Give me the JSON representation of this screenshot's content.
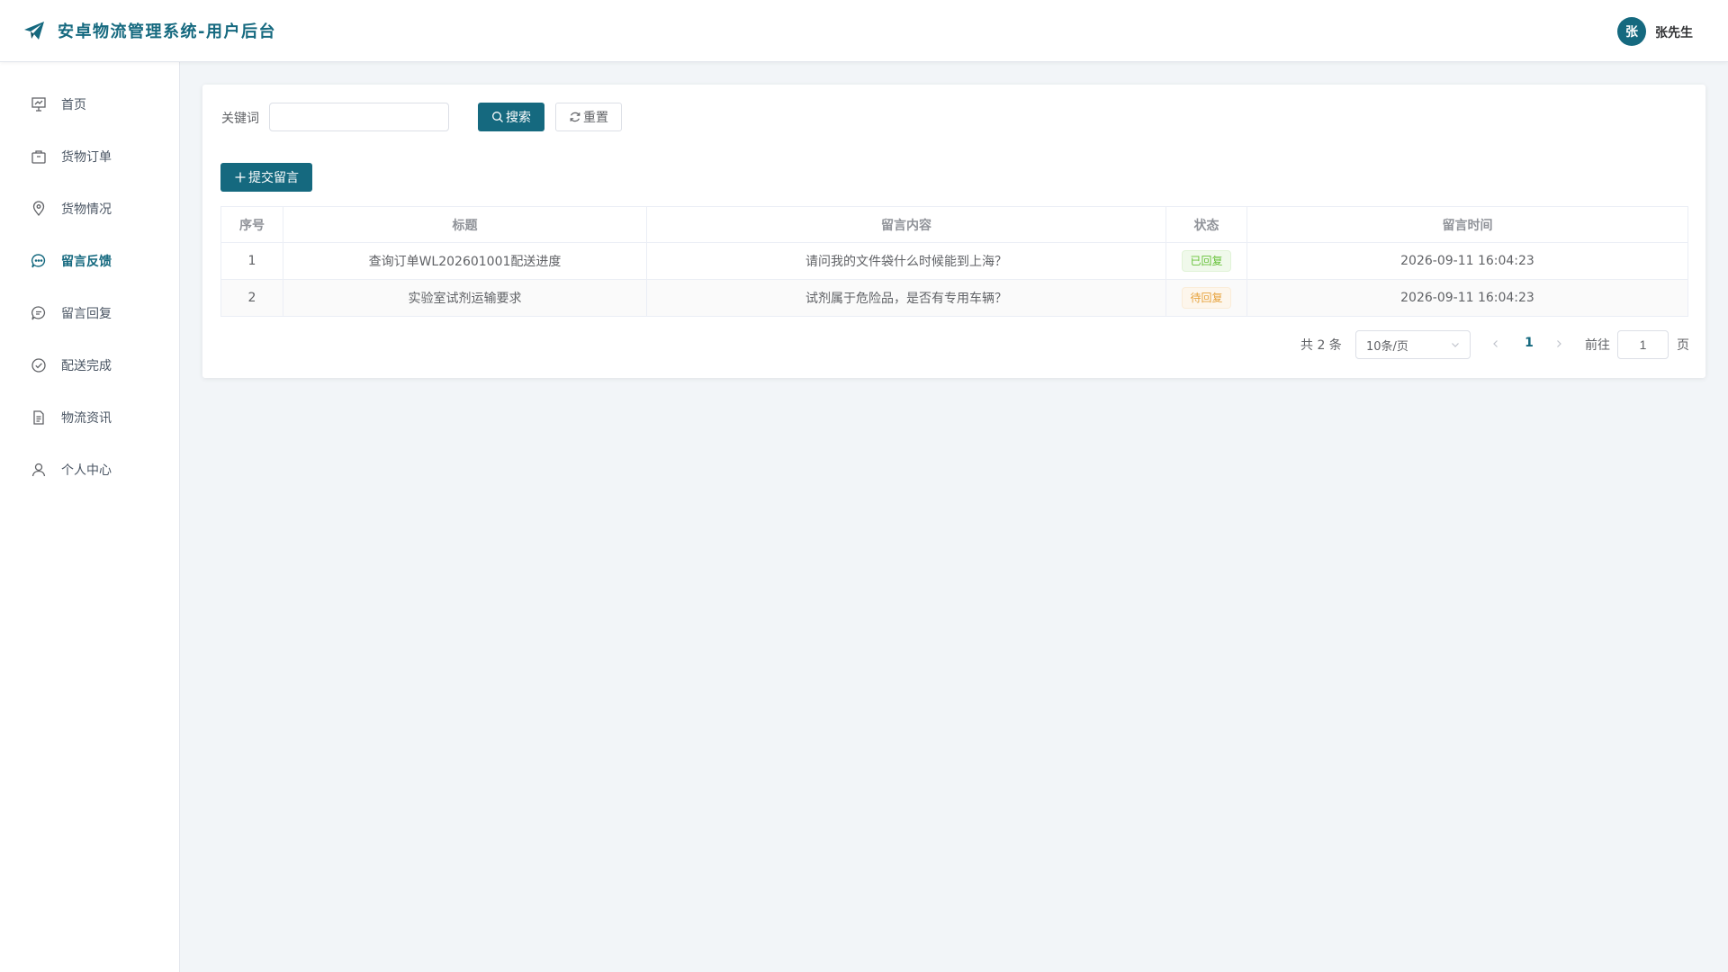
{
  "header": {
    "app_title": "安卓物流管理系统-用户后台",
    "avatar_text": "张",
    "username": "张先生"
  },
  "colors": {
    "primary": "#15697f",
    "success": "#67c23a",
    "warning": "#e6a23c"
  },
  "sidebar": {
    "items": [
      {
        "label": "首页",
        "icon": "dashboard-icon"
      },
      {
        "label": "货物订单",
        "icon": "package-icon"
      },
      {
        "label": "货物情况",
        "icon": "location-pin-icon"
      },
      {
        "label": "留言反馈",
        "icon": "chat-bubble-icon",
        "active": true
      },
      {
        "label": "留言回复",
        "icon": "reply-bubble-icon"
      },
      {
        "label": "配送完成",
        "icon": "check-circle-icon"
      },
      {
        "label": "物流资讯",
        "icon": "document-icon"
      },
      {
        "label": "个人中心",
        "icon": "user-icon"
      }
    ]
  },
  "search": {
    "keyword_label": "关键词",
    "keyword_value": "",
    "search_label": "搜索",
    "reset_label": "重置"
  },
  "actions": {
    "submit_label": "提交留言"
  },
  "table": {
    "columns": [
      "序号",
      "标题",
      "留言内容",
      "状态",
      "留言时间"
    ],
    "rows": [
      {
        "index": "1",
        "title": "查询订单WL202601001配送进度",
        "content": "请问我的文件袋什么时候能到上海？",
        "status": "已回复",
        "status_type": "success",
        "time": "2026-09-11 16:04:23"
      },
      {
        "index": "2",
        "title": "实验室试剂运输要求",
        "content": "试剂属于危险品，是否有专用车辆？",
        "status": "待回复",
        "status_type": "warning",
        "time": "2026-09-11 16:04:23"
      }
    ]
  },
  "pagination": {
    "total_text": "共 2 条",
    "page_size": "10条/页",
    "current_page": "1",
    "goto_label": "前往",
    "goto_value": "1",
    "page_suffix": "页"
  }
}
